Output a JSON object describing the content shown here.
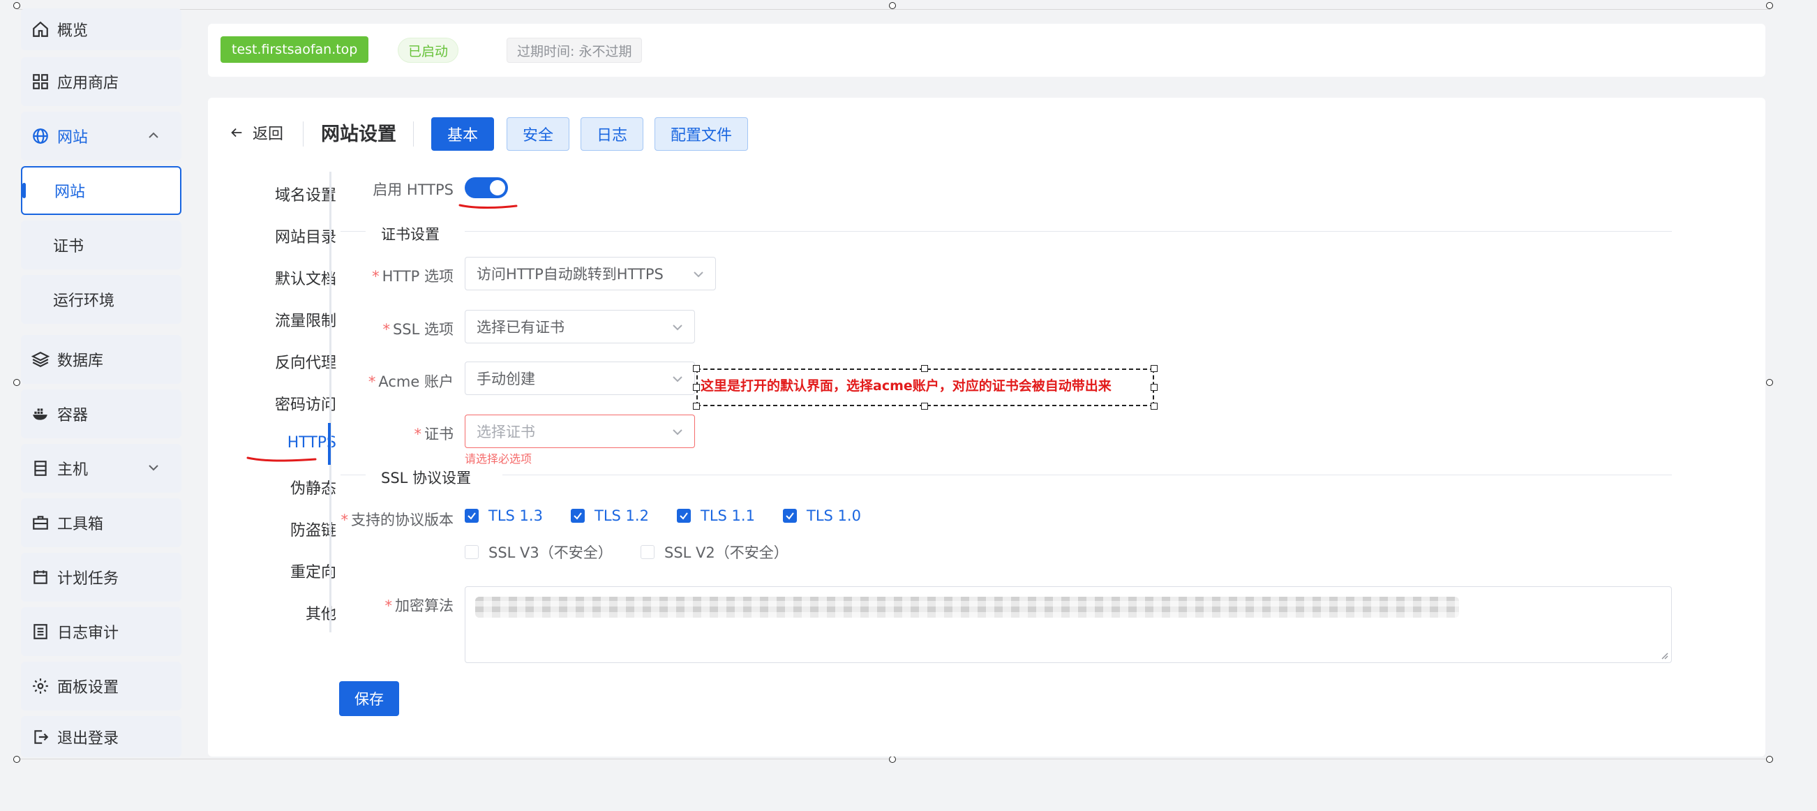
{
  "sidebar": {
    "overview": "概览",
    "app_store": "应用商店",
    "website_group": "网站",
    "website": "网站",
    "certificate": "证书",
    "runtime": "运行环境",
    "database": "数据库",
    "container": "容器",
    "host": "主机",
    "toolbox": "工具箱",
    "cron": "计划任务",
    "log_audit": "日志审计",
    "panel_settings": "面板设置",
    "logout": "退出登录"
  },
  "topbar": {
    "domain_tag": "test.firstsaofan.top",
    "status_tag": "已启动",
    "expire_tag": "过期时间: 永不过期"
  },
  "header": {
    "back": "返回",
    "title": "网站设置",
    "tabs": [
      "基本",
      "安全",
      "日志",
      "配置文件"
    ]
  },
  "menu": [
    "域名设置",
    "网站目录",
    "默认文档",
    "流量限制",
    "反向代理",
    "密码访问",
    "HTTPS",
    "伪静态",
    "防盗链",
    "重定向",
    "其他"
  ],
  "form": {
    "enable_https_label": "启用 HTTPS",
    "enable_https": true,
    "cert_section": "证书设置",
    "http_option_label": "HTTP 选项",
    "http_option_value": "访问HTTP自动跳转到HTTPS",
    "ssl_option_label": "SSL 选项",
    "ssl_option_value": "选择已有证书",
    "acme_label": "Acme 账户",
    "acme_value": "手动创建",
    "cert_label": "证书",
    "cert_placeholder": "选择证书",
    "cert_error": "请选择必选项",
    "protocol_section": "SSL 协议设置",
    "protocol_label": "支持的协议版本",
    "protocols_checked": [
      "TLS 1.3",
      "TLS 1.2",
      "TLS 1.1",
      "TLS 1.0"
    ],
    "protocols_unchecked": [
      "SSL V3（不安全）",
      "SSL V2（不安全）"
    ],
    "cipher_label": "加密算法",
    "save": "保存"
  },
  "annotation": {
    "note": "这里是打开的默认界面，选择acme账户，对应的证书会被自动带出来"
  },
  "colors": {
    "primary": "#1a66e0",
    "success": "#67c23a",
    "danger": "#f56c6c",
    "annotation": "#e21b1b"
  }
}
